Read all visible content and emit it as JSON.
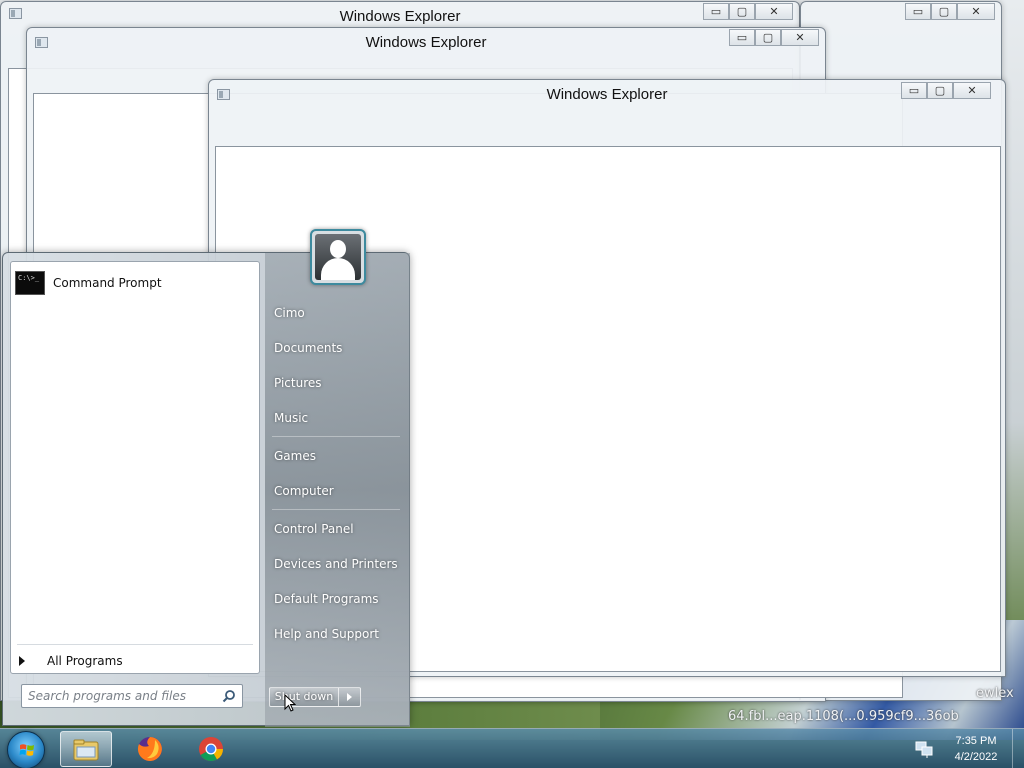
{
  "windows": [
    {
      "title": "Windows Explorer"
    },
    {
      "title": "Windows Explorer"
    },
    {
      "title": "Windows Explorer"
    }
  ],
  "window_controls": {
    "minimize": "▭",
    "maximize": "▢",
    "close": "✕"
  },
  "start_menu": {
    "pinned": [
      {
        "label": "Command Prompt",
        "icon": "command-prompt-icon",
        "icon_text": "C:\\>_"
      }
    ],
    "all_programs_label": "All Programs",
    "search_placeholder": "Search programs and files",
    "user_icon": "user-avatar-icon",
    "right_items": [
      {
        "label": "Cimo"
      },
      {
        "label": "Documents"
      },
      {
        "label": "Pictures"
      },
      {
        "label": "Music"
      },
      {
        "label": "Games"
      },
      {
        "label": "Computer"
      },
      {
        "label": "Control Panel"
      },
      {
        "label": "Devices and Printers"
      },
      {
        "label": "Default Programs"
      },
      {
        "label": "Help and Support"
      }
    ],
    "shutdown_label": "Shut down"
  },
  "background_text": {
    "line1": "ewlex",
    "line2": "64.fbl...eap.1108(...0.959cf9...36ob"
  },
  "taskbar": {
    "items": [
      {
        "icon": "windows-explorer-icon",
        "active": true
      },
      {
        "icon": "firefox-icon",
        "active": false
      },
      {
        "icon": "chrome-icon",
        "active": false
      }
    ],
    "tray_icon": "network-icon",
    "clock": {
      "time": "7:35 PM",
      "date": "4/2/2022"
    }
  },
  "colors": {
    "taskbar": "#2e5a7a",
    "avatar_border": "#3d8a9e",
    "start_orb": "#2b88c8"
  }
}
